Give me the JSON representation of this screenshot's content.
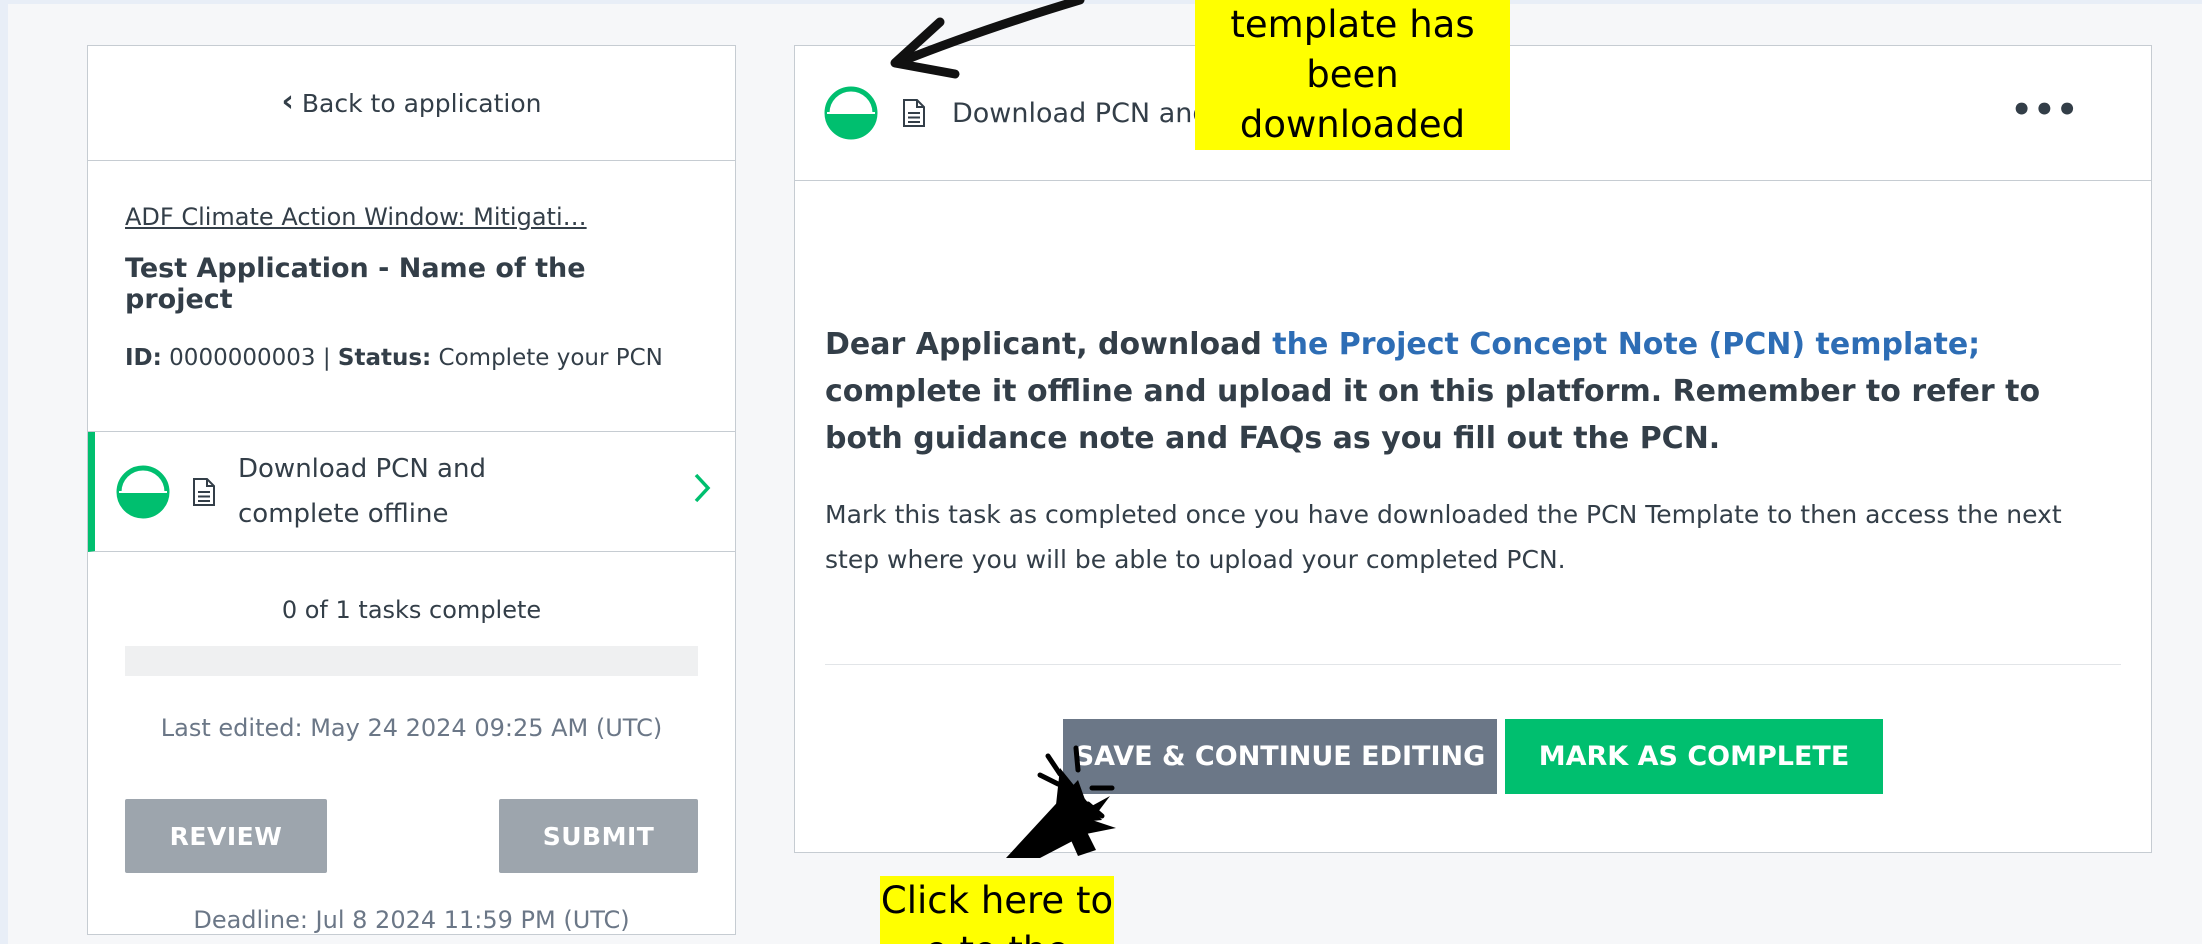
{
  "left_panel": {
    "back_label": "Back to application",
    "program_link": "ADF Climate Action Window: Mitigati…",
    "application_title": "Test Application - Name of the project",
    "id_label": "ID:",
    "id_value": "0000000003",
    "separator": "|",
    "status_label": "Status:",
    "status_value": "Complete your PCN",
    "task": {
      "label_line1": "Download PCN and",
      "label_line2": "complete offline"
    },
    "progress_text": "0 of 1 tasks complete",
    "progress_fraction": 0,
    "last_edited": "Last edited: May 24 2024 09:25 AM (UTC)",
    "review_label": "REVIEW",
    "submit_label": "SUBMIT",
    "deadline": "Deadline: Jul 8 2024 11:59 PM (UTC)"
  },
  "right_panel": {
    "header_title": "Download PCN and complete offline",
    "more_label": "•••",
    "intro_prefix": "Dear Applicant, download ",
    "intro_link": "the Project Concept Note (PCN) template;",
    "intro_suffix": " complete it offline and upload it on this platform. Remember to refer to both guidance note and FAQs as you fill out the PCN.",
    "note": "Mark this task as completed once you have downloaded the PCN Template to then access the next step where you will be able to upload your completed PCN.",
    "save_label": "SAVE & CONTINUE EDITING",
    "complete_label": "MARK AS COMPLETE"
  },
  "annotations": {
    "top_line1": "template has been",
    "top_line2": "downloaded",
    "bottom_line1": "Click here to",
    "bottom_line2": "e to the"
  },
  "icons": {
    "status": "half-filled-circle-icon",
    "document": "document-icon",
    "back": "chevron-left-icon",
    "open": "chevron-right-icon",
    "more": "ellipsis-icon",
    "pointer": "arrow-annotation-icon",
    "cursor": "click-cursor-icon"
  },
  "colors": {
    "accent_green": "#00bf6f",
    "link_blue": "#2d6db5",
    "disabled_grey": "#9da5ad",
    "dark_button": "#6b7787",
    "highlight": "#ffff00"
  }
}
